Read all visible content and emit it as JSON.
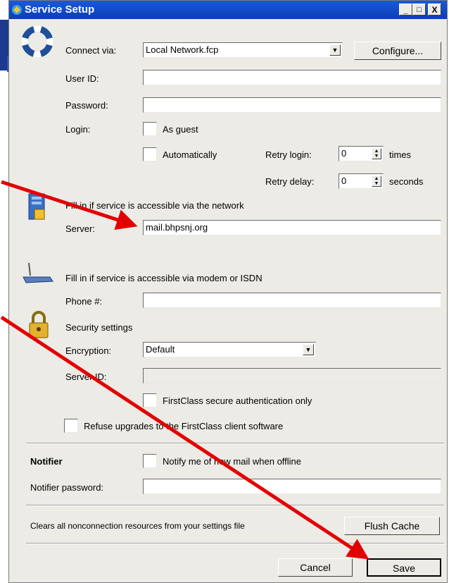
{
  "window": {
    "title": "Service Setup",
    "minimize": "_",
    "maximize": "□",
    "close": "X"
  },
  "connect": {
    "label": "Connect via:",
    "value": "Local Network.fcp",
    "configure": "Configure..."
  },
  "user_id": {
    "label": "User ID:",
    "value": ""
  },
  "password": {
    "label": "Password:",
    "value": ""
  },
  "login": {
    "label": "Login:",
    "as_guest": "As guest",
    "automatically": "Automatically",
    "retry_login_label": "Retry login:",
    "retry_login_value": "0",
    "retry_login_unit": "times",
    "retry_delay_label": "Retry delay:",
    "retry_delay_value": "0",
    "retry_delay_unit": "seconds"
  },
  "network": {
    "heading": "Fill in if service is accessible via the network",
    "server_label": "Server:",
    "server_value": "mail.bhpsnj.org"
  },
  "modem": {
    "heading": "Fill in if service is accessible via modem or ISDN",
    "phone_label": "Phone #:",
    "phone_value": ""
  },
  "security": {
    "heading": "Security settings",
    "encryption_label": "Encryption:",
    "encryption_value": "Default",
    "server_id_label": "Server ID:",
    "server_id_value": "",
    "secure_auth": "FirstClass secure authentication only",
    "refuse_upgrades": "Refuse upgrades to the FirstClass client software"
  },
  "notifier": {
    "heading": "Notifier",
    "notify_label": "Notify me of new mail when offline",
    "password_label": "Notifier password:",
    "password_value": ""
  },
  "cache": {
    "text": "Clears all nonconnection resources from your settings file",
    "button": "Flush Cache"
  },
  "footer": {
    "cancel": "Cancel",
    "save": "Save"
  },
  "colors": {
    "annotation_arrow": "#e30000",
    "titlebar": "#0a3fb5"
  }
}
